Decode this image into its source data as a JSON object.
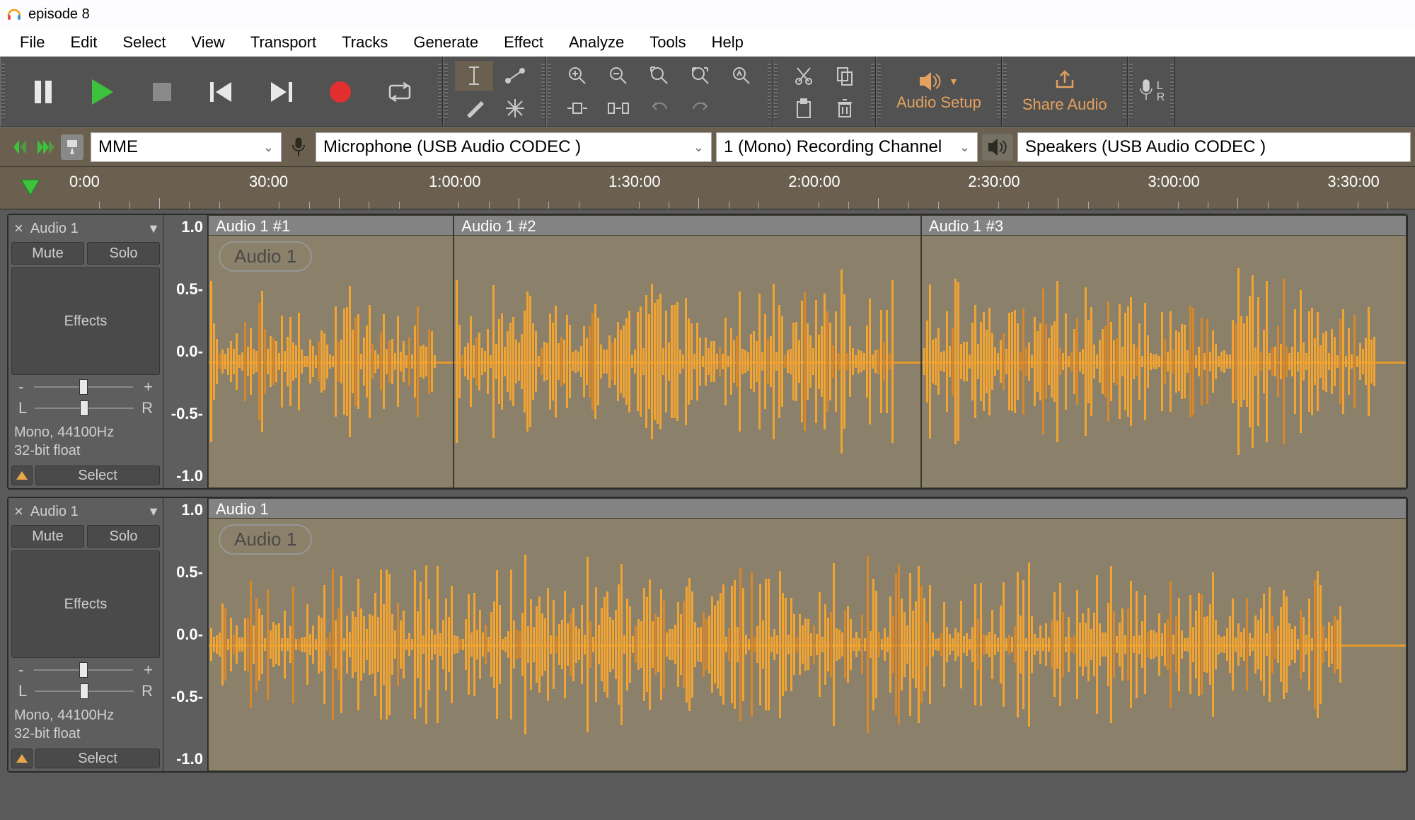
{
  "app": {
    "title": "episode 8"
  },
  "menu": {
    "items": [
      "File",
      "Edit",
      "Select",
      "View",
      "Transport",
      "Tracks",
      "Generate",
      "Effect",
      "Analyze",
      "Tools",
      "Help"
    ]
  },
  "toolbar": {
    "audio_setup": "Audio Setup",
    "share_audio": "Share Audio",
    "lr_label_top": "L",
    "lr_label_bottom": "R"
  },
  "devices": {
    "host": "MME",
    "recording": "Microphone (USB Audio CODEC )",
    "channels": "1 (Mono) Recording Channel",
    "playback": "Speakers (USB Audio CODEC )"
  },
  "timeline": {
    "labels": [
      "0:00",
      "30:00",
      "1:00:00",
      "1:30:00",
      "2:00:00",
      "2:30:00",
      "3:00:00",
      "3:30:00"
    ]
  },
  "tracks": [
    {
      "name": "Audio 1",
      "mute": "Mute",
      "solo": "Solo",
      "effects": "Effects",
      "gain_minus": "-",
      "gain_plus": "+",
      "pan_l": "L",
      "pan_r": "R",
      "info1": "Mono, 44100Hz",
      "info2": "32-bit float",
      "select": "Select",
      "scale": [
        "1.0",
        "0.5-",
        "0.0-",
        "-0.5-",
        "-1.0"
      ],
      "clips": [
        {
          "header": "Audio 1 #1",
          "badge": "Audio 1",
          "width": "20.5%"
        },
        {
          "header": "Audio 1 #2",
          "badge": "",
          "width": "39%"
        },
        {
          "header": "Audio 1 #3",
          "badge": "",
          "width": "40.5%"
        }
      ]
    },
    {
      "name": "Audio 1",
      "mute": "Mute",
      "solo": "Solo",
      "effects": "Effects",
      "gain_minus": "-",
      "gain_plus": "+",
      "pan_l": "L",
      "pan_r": "R",
      "info1": "Mono, 44100Hz",
      "info2": "32-bit float",
      "select": "Select",
      "scale": [
        "1.0",
        "0.5-",
        "0.0-",
        "-0.5-",
        "-1.0"
      ],
      "clips": [
        {
          "header": "Audio 1",
          "badge": "Audio 1",
          "width": "100%"
        }
      ]
    }
  ]
}
